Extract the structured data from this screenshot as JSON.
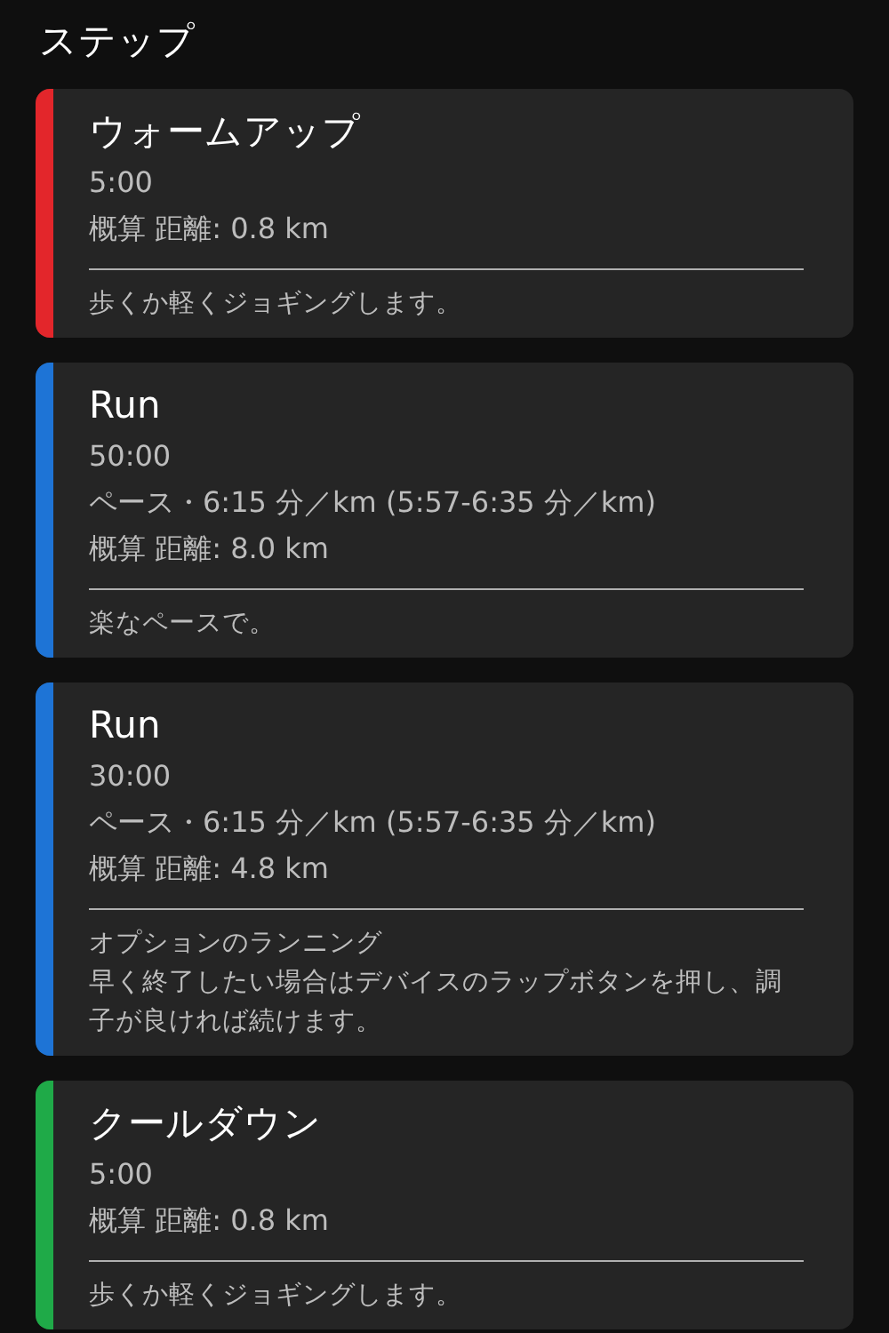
{
  "section_title": "ステップ",
  "steps": [
    {
      "color": "#e3262b",
      "title": "ウォームアップ",
      "details": [
        "5:00",
        "概算 距離: 0.8 km"
      ],
      "notes": [
        "歩くか軽くジョギングします。"
      ]
    },
    {
      "color": "#1e74d6",
      "title": "Run",
      "details": [
        "50:00",
        "ペース・6:15 分／km (5:57-6:35 分／km)",
        "概算 距離: 8.0 km"
      ],
      "notes": [
        "楽なペースで。"
      ]
    },
    {
      "color": "#1e74d6",
      "title": "Run",
      "details": [
        "30:00",
        "ペース・6:15 分／km (5:57-6:35 分／km)",
        "概算 距離: 4.8 km"
      ],
      "notes": [
        "オプションのランニング",
        "早く終了したい場合はデバイスのラップボタンを押し、調子が良ければ続けます。"
      ]
    },
    {
      "color": "#1faa48",
      "title": "クールダウン",
      "details": [
        "5:00",
        "概算 距離: 0.8 km"
      ],
      "notes": [
        "歩くか軽くジョギングします。"
      ]
    }
  ]
}
